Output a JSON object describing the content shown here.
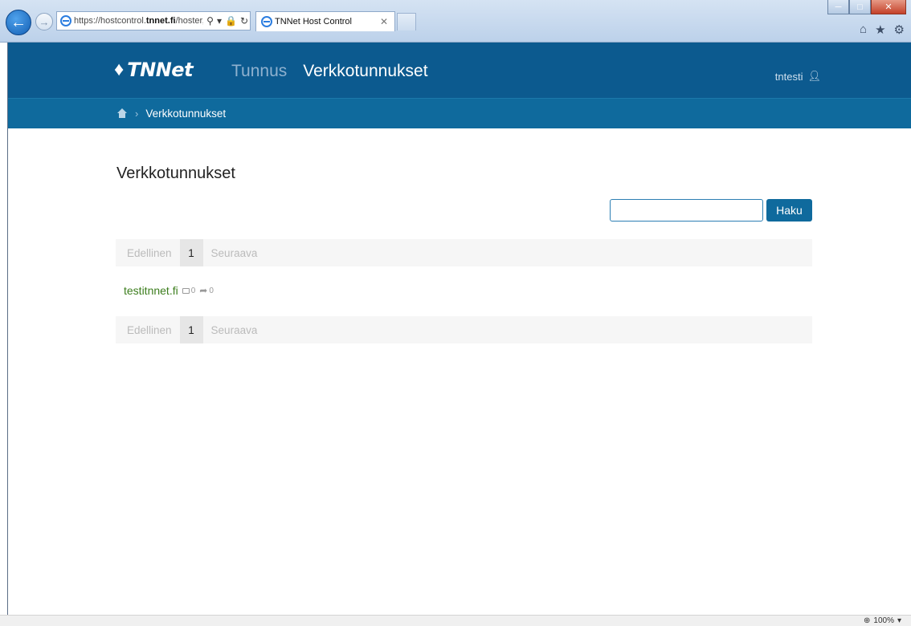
{
  "browser": {
    "url_prefix": "https://hostcontrol.",
    "url_host": "tnnet.fi",
    "url_rest": "/hoster,",
    "tab_title": "TNNet Host Control",
    "zoom": "100%"
  },
  "site": {
    "logo_text": "TNNet",
    "nav": [
      {
        "label": "Tunnus",
        "active": false
      },
      {
        "label": "Verkkotunnukset",
        "active": true
      }
    ],
    "user": "tntesti",
    "breadcrumb": {
      "current": "Verkkotunnukset"
    }
  },
  "main": {
    "title": "Verkkotunnukset",
    "search": {
      "value": "",
      "button_label": "Haku"
    },
    "pager": {
      "prev": "Edellinen",
      "page": "1",
      "next": "Seuraava"
    },
    "domains": [
      {
        "name": "testitnnet.fi",
        "mail_count": "0",
        "forward_count": "0"
      }
    ]
  },
  "colors": {
    "header": "#0c5a8f",
    "breadcrumb": "#0f6a9d",
    "link_green": "#3c7d1d"
  }
}
